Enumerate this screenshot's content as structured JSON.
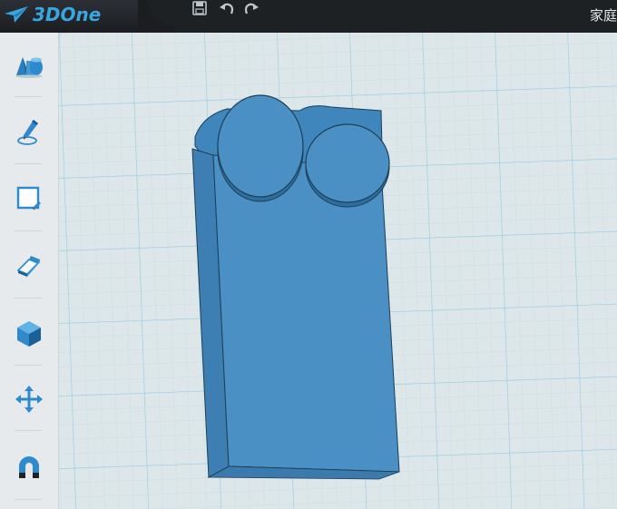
{
  "app": {
    "logo_text": "3DOne",
    "window_title": "家庭"
  },
  "toolbar": {
    "icons": [
      "save-icon",
      "undo-icon",
      "redo-icon"
    ]
  },
  "sidebar": {
    "items": [
      {
        "name": "sidebar-item-basic-shapes",
        "icon": "shapes-icon"
      },
      {
        "name": "sidebar-item-sketch",
        "icon": "pen-icon"
      },
      {
        "name": "sidebar-item-sketch-edit",
        "icon": "sketch-rect-icon"
      },
      {
        "name": "sidebar-item-special-features",
        "icon": "eraser-icon"
      },
      {
        "name": "sidebar-item-feature-modeling",
        "icon": "cube-icon"
      },
      {
        "name": "sidebar-item-move",
        "icon": "move-arrows-icon"
      },
      {
        "name": "sidebar-item-adsorb",
        "icon": "magnet-icon"
      }
    ]
  },
  "colors": {
    "accent": "#3aa6e0",
    "model": "#4b90c4",
    "grid": "#a8d8e4",
    "grid_background": "#dde6e8"
  }
}
